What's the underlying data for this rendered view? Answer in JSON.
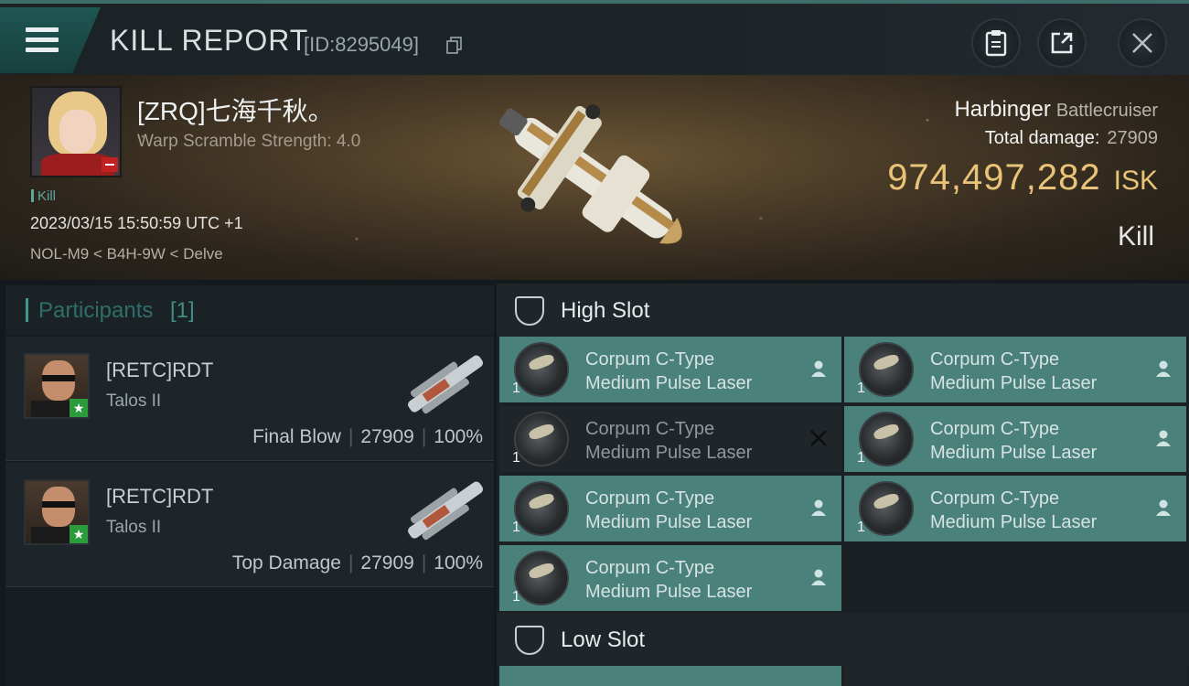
{
  "header": {
    "title": "KILL REPORT",
    "report_id": "[ID:8295049]"
  },
  "victim": {
    "name": "[ZRQ]七海千秋。",
    "warp_scramble": "Warp Scramble Strength: 4.0",
    "tag": "Kill",
    "datetime": "2023/03/15 15:50:59 UTC +1",
    "location": "NOL-M9 < B4H-9W < Delve"
  },
  "ship": {
    "name": "Harbinger",
    "class": "Battlecruiser",
    "total_damage_label": "Total damage:",
    "total_damage": "27909",
    "isk_value": "974,497,282",
    "isk_unit": "ISK",
    "kill_type": "Kill"
  },
  "participants": {
    "title": "Participants",
    "count": "[1]",
    "items": [
      {
        "name": "[RETC]RDT",
        "ship": "Talos II",
        "role": "Final Blow",
        "damage": "27909",
        "percent": "100%"
      },
      {
        "name": "[RETC]RDT",
        "ship": "Talos II",
        "role": "Top Damage",
        "damage": "27909",
        "percent": "100%"
      }
    ]
  },
  "high_slot": {
    "title": "High Slot",
    "modules": [
      {
        "line1": "Corpum C-Type",
        "line2": "Medium Pulse Laser",
        "qty": "1",
        "status": "dropped"
      },
      {
        "line1": "Corpum C-Type",
        "line2": "Medium Pulse Laser",
        "qty": "1",
        "status": "dropped"
      },
      {
        "line1": "Corpum C-Type",
        "line2": "Medium Pulse Laser",
        "qty": "1",
        "status": "destroyed"
      },
      {
        "line1": "Corpum C-Type",
        "line2": "Medium Pulse Laser",
        "qty": "1",
        "status": "dropped"
      },
      {
        "line1": "Corpum C-Type",
        "line2": "Medium Pulse Laser",
        "qty": "1",
        "status": "dropped"
      },
      {
        "line1": "Corpum C-Type",
        "line2": "Medium Pulse Laser",
        "qty": "1",
        "status": "dropped"
      },
      {
        "line1": "Corpum C-Type",
        "line2": "Medium Pulse Laser",
        "qty": "1",
        "status": "dropped"
      }
    ]
  },
  "low_slot": {
    "title": "Low Slot"
  },
  "colors": {
    "accent": "#3e9b91",
    "isk": "#e9c378",
    "module_dropped": "#4b817b",
    "module_destroyed": "#1f2529"
  },
  "icons": [
    "menu-icon",
    "copy-icon",
    "clipboard-icon",
    "share-icon",
    "close-icon",
    "slot-icon",
    "person-icon",
    "x-icon"
  ]
}
